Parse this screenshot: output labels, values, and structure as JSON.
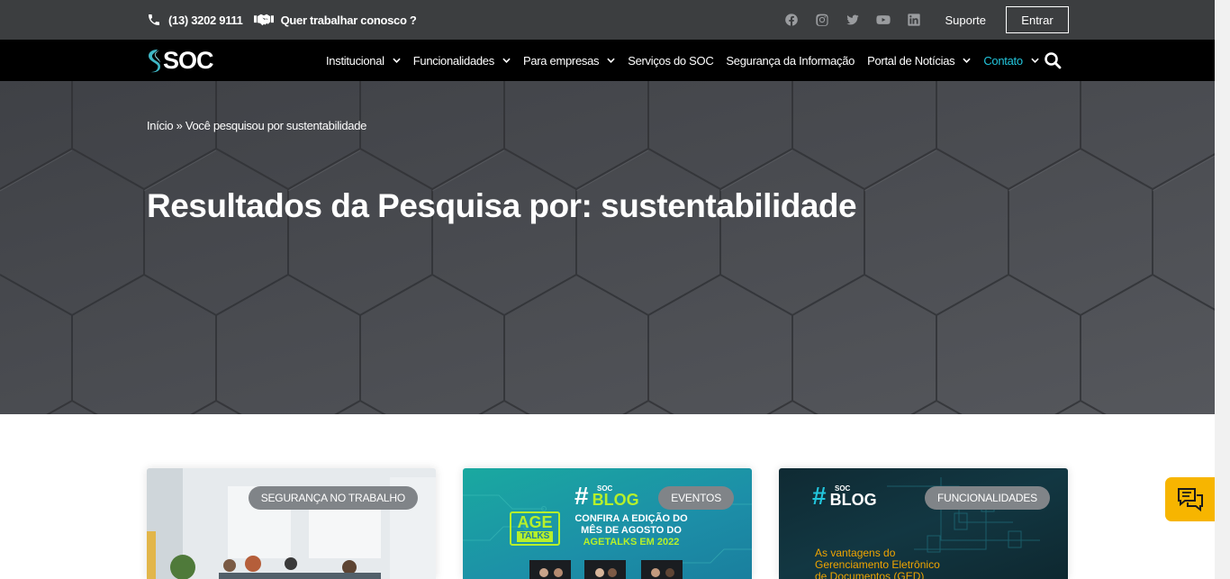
{
  "topbar": {
    "phone": "(13) 3202 9111",
    "work_with_us": "Quer trabalhar conosco ?",
    "social": [
      "facebook-icon",
      "instagram-icon",
      "twitter-icon",
      "youtube-icon",
      "linkedin-icon"
    ],
    "support": "Suporte",
    "login": "Entrar"
  },
  "nav": {
    "logo": "SOC",
    "items": [
      {
        "label": "Institucional",
        "dropdown": true
      },
      {
        "label": "Funcionalidades",
        "dropdown": true
      },
      {
        "label": "Para empresas",
        "dropdown": true
      },
      {
        "label": "Serviços do SOC",
        "dropdown": false
      },
      {
        "label": "Segurança da Informação",
        "dropdown": false
      },
      {
        "label": "Portal de Notícias",
        "dropdown": true
      },
      {
        "label": "Contato",
        "dropdown": true,
        "active": true
      }
    ]
  },
  "hero": {
    "breadcrumb": "Início » Você pesquisou por sustentabilidade",
    "title": "Resultados da Pesquisa por: sustentabilidade"
  },
  "cards": [
    {
      "tag": "SEGURANÇA NO TRABALHO"
    },
    {
      "tag": "EVENTOS",
      "brand": "SOC",
      "blog": "BLOG",
      "age": "AGE",
      "talks": "TALKS",
      "headline_1": "CONFIRA A EDIÇÃO DO",
      "headline_2": "MÊS DE AGOSTO DO",
      "headline_3": "AGETALKS EM 2022"
    },
    {
      "tag": "FUNCIONALIDADES",
      "brand": "SOC",
      "blog": "BLOG",
      "headline_1": "As vantagens do",
      "headline_2": "Gerenciamento Eletrônico",
      "headline_3": "de Documentos (GED)"
    }
  ],
  "colors": {
    "accent": "#22c5dc",
    "chat": "#f7b500",
    "topbar": "#3c3e40"
  }
}
